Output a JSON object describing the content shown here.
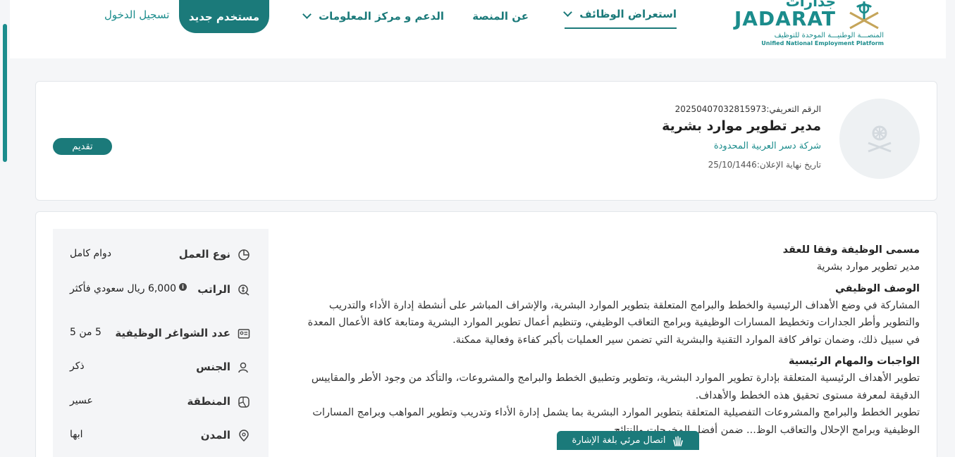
{
  "header": {
    "logo": {
      "arabic_word": "جدارات",
      "english_word": "JADARAT",
      "tagline_ar": "المنصـــة الوطنيـــة الموحدة للتوظيف",
      "tagline_en": "Unified National Employment Platform"
    },
    "nav": {
      "jobs": "استعراض الوظائف",
      "about": "عن المنصة",
      "support": "الدعم و مركز المعلومات"
    },
    "new_user": "مستخدم جديد",
    "login": "تسجيل الدخول"
  },
  "job": {
    "ref_label": "الرقم التعريفي:",
    "ref_number": "20250407032815973",
    "title": "مدير تطوير موارد بشرية",
    "company": "شركة دسر العربية المحدودة",
    "deadline_label": "تاريخ نهاية الإعلان:",
    "deadline": "25/10/1446",
    "apply": "تقديم"
  },
  "attributes": [
    {
      "icon": "pie-chart-icon",
      "label": "نوع العمل",
      "value": "دوام كامل"
    },
    {
      "icon": "money-icon",
      "label": "الراتب",
      "value": "6,000 ريال سعودي فأكثر"
    },
    {
      "icon": "id-card-icon",
      "label": "عدد الشواغر الوظيفية",
      "value": "5 من 5"
    },
    {
      "icon": "user-icon",
      "label": "الجنس",
      "value": "ذكر"
    },
    {
      "icon": "map-icon",
      "label": "المنطقة",
      "value": "عسير"
    },
    {
      "icon": "location-pin-icon",
      "label": "المدن",
      "value": "ابها"
    }
  ],
  "description": {
    "title_heading": "مسمى الوظيفة وفقا للعقد",
    "title_text": "مدير تطوير موارد بشرية",
    "desc_heading": "الوصف الوظيفي",
    "desc_text": "المشاركة في وضع الأهداف الرئيسية والخطط والبرامج المتعلقة بتطوير الموارد البشرية، والإشراف المباشر على أنشطة إدارة الأداء والتدريب والتطوير وأطر الجدارات وتخطيط المسارات الوظيفية وبرامج التعاقب الوظيفي، وتنظيم أعمال تطوير الموارد البشرية ومتابعة كافة الأعمال المعدة في سبيل ذلك، وضمان توافر كافة الموارد التقنية والبشرية التي تضمن سير العمليات بأكبر كفاءة وفعالية ممكنة.",
    "duties_heading": "الواجبات والمهام الرئيسية",
    "duties_1": "تطوير الأهداف الرئيسية المتعلقة بإدارة تطوير الموارد البشرية، وتطوير وتطبيق الخطط والبرامج والمشروعات، والتأكد من وجود الأطر والمقاييس الدقيقة لمعرفة مستوى تحقيق هذه الخطط والأهداف.",
    "duties_2": "تطوير الخطط والبرامج والمشروعات التفصيلية المتعلقة بتطوير الموارد البشرية بما يشمل إدارة الأداء وتدريب وتطوير المواهب وبرامج المسارات الوظيفية وبرامج الإحلال والتعاقب الوظ... ضمن أفضل المخرجات والنتائج."
  },
  "sign_language": "اتصال مرئي بلغة الإشارة",
  "colors": {
    "primary": "#1b7a7a",
    "accent": "#1b8c8c"
  }
}
